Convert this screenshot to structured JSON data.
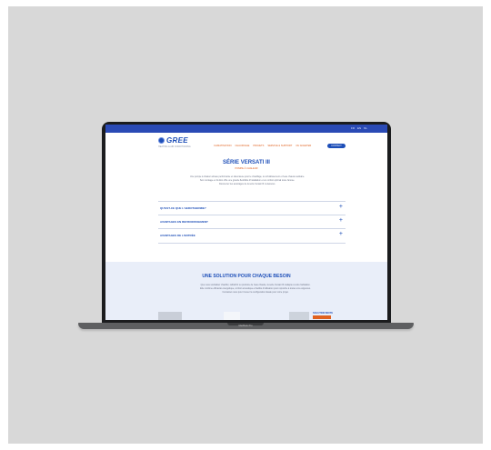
{
  "device": {
    "model_label": "MacBook Pro"
  },
  "site": {
    "top_links": [
      "FR",
      "EN",
      "NL"
    ],
    "logo_text": "GREE",
    "logo_subtitle": "HEATING & AIR CONDITIONING",
    "nav_items": [
      "CLIMATISATION",
      "CHAUFFAGE",
      "PROJETS",
      "SERVICE & SUPPORT",
      "OU ACHETER"
    ],
    "cta_label": "CONTACT"
  },
  "hero": {
    "title": "SÉRIE VERSATI III",
    "subtitle": "POMPE À CHALEUR",
    "intro_lines": [
      "Une pompe à chaleur air/eau performante et silencieuse pour le chauffage, le refroidissement et l'eau chaude sanitaire.",
      "Son montage en bi-bloc offre une grande flexibilité d'installation et un confort optimal toute l'année.",
      "Découvrez les avantages de la série Versati III ci-dessous."
    ]
  },
  "accordion": [
    {
      "label": "QU'EST-CE QUE L'AEROTHERMIE?"
    },
    {
      "label": "AVANTAGES EN REFROIDISSEMENT"
    },
    {
      "label": "AVANTAGES DE L'ENTRÉE"
    }
  ],
  "solution": {
    "title": "UNE SOLUTION POUR CHAQUE BESOIN",
    "text_lines": [
      "Que vous souhaitiez chauffer, rafraîchir ou produire de l'eau chaude, la série Versati III s'adapte à votre habitation.",
      "Elle combine efficacité énergétique, confort acoustique et facilité d'utilisation pour répondre à toutes vos exigences.",
      "Contactez-nous pour trouver la configuration idéale pour votre projet."
    ],
    "cta_label": "SOLUTION MIXTE"
  },
  "colors": {
    "brand_blue": "#1e4fb8",
    "accent_orange": "#e0611f",
    "mockup_background": "#d8d8d8"
  }
}
